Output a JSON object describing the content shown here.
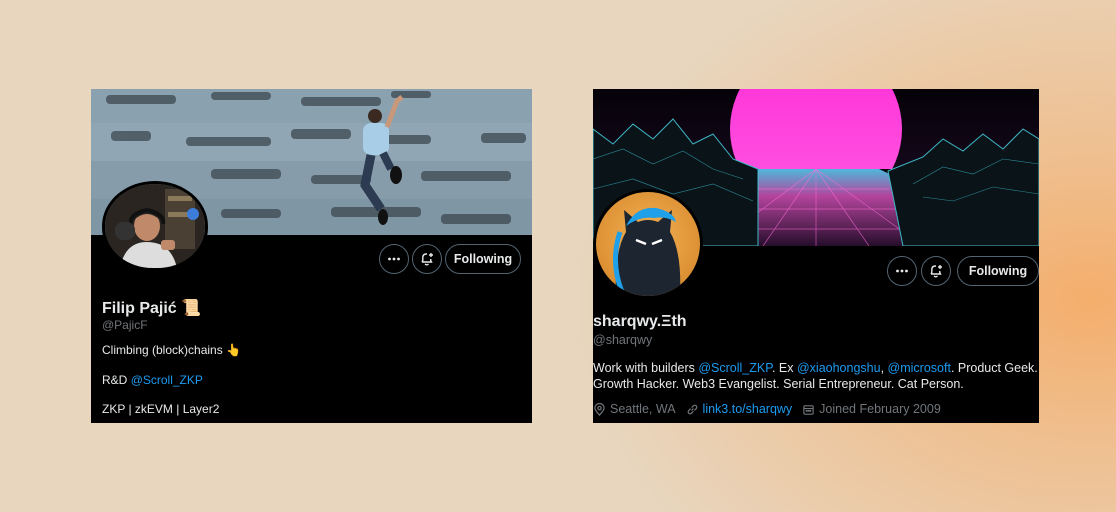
{
  "card1": {
    "name": "Filip Pajić",
    "name_emoji": "📜",
    "handle": "@PajicF",
    "bio_line1": "Climbing (block)chains",
    "bio_line1_emoji": "👆",
    "bio_line2_prefix": "R&D",
    "bio_line2_mention": "@Scroll_ZKP",
    "bio_line3": "ZKP | zkEVM | Layer2",
    "follow_label": "Following"
  },
  "card2": {
    "name": "sharqwy.Ξth",
    "handle": "@sharqwy",
    "bio_p1": "Work with builders ",
    "bio_m1": "@Scroll_ZKP",
    "bio_p2": ". Ex ",
    "bio_m2": "@xiaohongshu",
    "bio_p3": ", ",
    "bio_m3": "@microsoft",
    "bio_p4": ".  Product Geek.",
    "bio_line2": "Growth Hacker. Web3 Evangelist. Serial Entrepreneur. Cat Person.",
    "location": "Seattle, WA",
    "website": "link3.to/sharqwy",
    "joined": "Joined February 2009",
    "follow_label": "Following"
  },
  "icons": {
    "more": "more-dots-icon",
    "notify": "bell-plus-icon",
    "location": "location-pin-icon",
    "link": "link-icon",
    "calendar": "calendar-icon"
  },
  "colors": {
    "link": "#1d9bf0",
    "muted": "#71767b",
    "text": "#e7e9ea"
  }
}
